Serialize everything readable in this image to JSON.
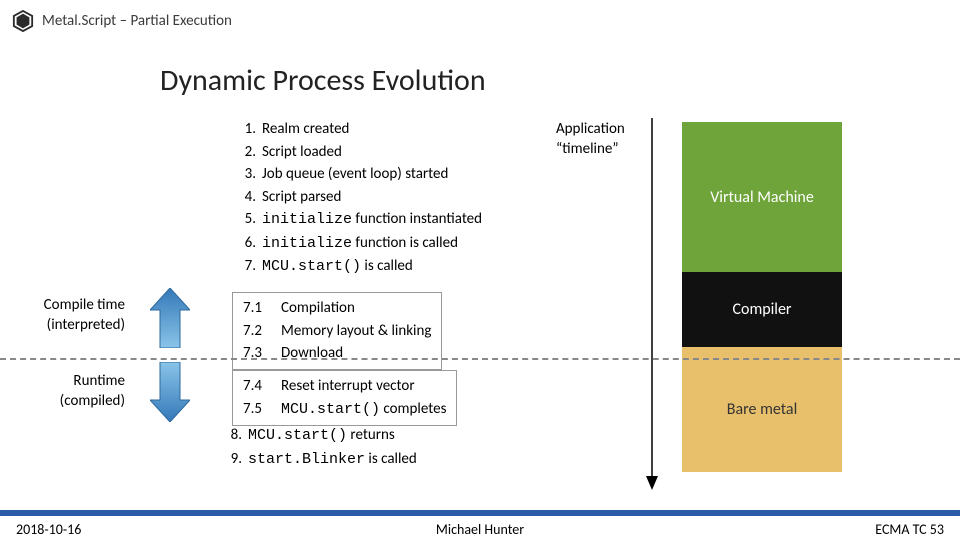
{
  "header": {
    "title": "Metal.Script – Partial Execution"
  },
  "title": "Dynamic Process Evolution",
  "steps": [
    {
      "n": "1.",
      "t": "Realm created"
    },
    {
      "n": "2.",
      "t": "Script loaded"
    },
    {
      "n": "3.",
      "t": "Job queue (event loop) started"
    },
    {
      "n": "4.",
      "t": "Script parsed"
    },
    {
      "n": "5.",
      "pre": "initialize",
      "post": " function instantiated"
    },
    {
      "n": "6.",
      "pre": "initialize",
      "post": " function is called"
    },
    {
      "n": "7.",
      "pre": "MCU.start()",
      "post": " is called"
    }
  ],
  "box1": [
    {
      "n": "7.1",
      "t": "Compilation"
    },
    {
      "n": "7.2",
      "t": "Memory layout & linking"
    },
    {
      "n": "7.3",
      "t": "Download"
    }
  ],
  "box2": [
    {
      "n": "7.4",
      "t": "Reset interrupt vector"
    },
    {
      "n": "7.5",
      "pre": "MCU.start()",
      "post": " completes"
    }
  ],
  "after": [
    {
      "n": "8.",
      "pre": "MCU.start()",
      "post": " returns"
    },
    {
      "n": "9.",
      "pre": "start.Blinker",
      "post": " is called"
    }
  ],
  "labels": {
    "compile1": "Compile time",
    "compile2": "(interpreted)",
    "runtime1": "Runtime",
    "runtime2": "(compiled)",
    "timeline1": "Application",
    "timeline2": "“timeline”"
  },
  "stack": {
    "vm": "Virtual Machine",
    "compiler": "Compiler",
    "bare": "Bare metal"
  },
  "footer": {
    "date": "2018-10-16",
    "author": "Michael Hunter",
    "right": "ECMA TC 53"
  }
}
